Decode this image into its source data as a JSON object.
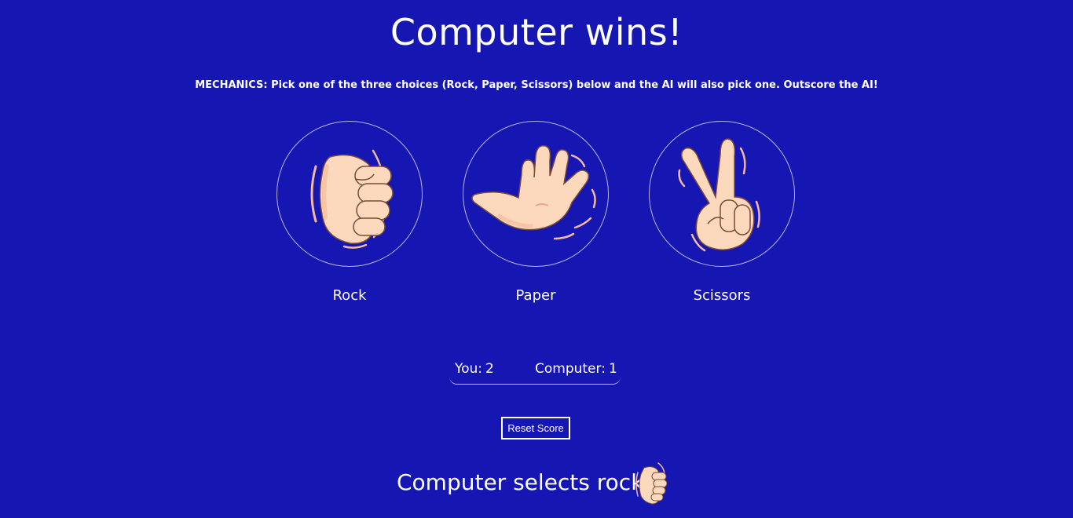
{
  "result": {
    "title": "Computer wins!"
  },
  "mechanics": {
    "text": "MECHANICS: Pick one of the three choices (Rock, Paper, Scissors) below and the AI will also pick one. Outscore the AI!"
  },
  "choices": [
    {
      "label": "Rock",
      "icon": "rock-fist-icon"
    },
    {
      "label": "Paper",
      "icon": "paper-hand-icon"
    },
    {
      "label": "Scissors",
      "icon": "scissors-hand-icon"
    }
  ],
  "score": {
    "you_label": "You:",
    "you_value": "2",
    "computer_label": "Computer:",
    "computer_value": "1"
  },
  "reset": {
    "label": "Reset Score"
  },
  "computer_selection": {
    "text": "Computer selects rock",
    "icon": "rock-fist-icon"
  },
  "colors": {
    "background": "#1616b2",
    "text": "#ffffff",
    "skin": "#fcd9bd",
    "skin_shade": "#f4b896",
    "outline": "#7a4b3a"
  }
}
